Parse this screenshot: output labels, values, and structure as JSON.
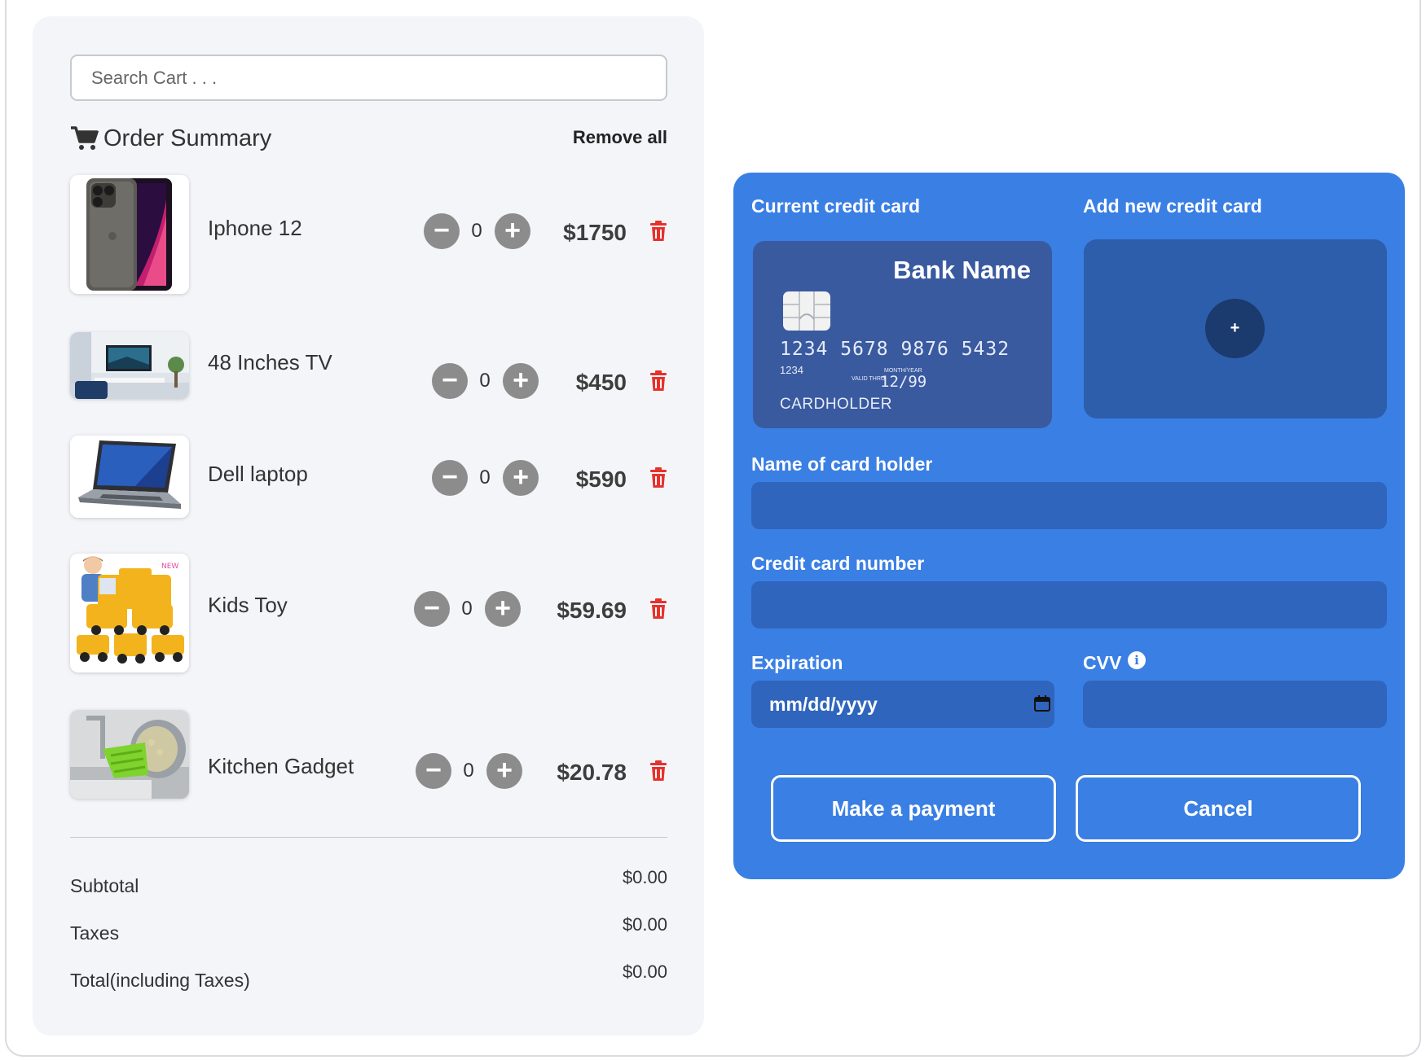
{
  "cart": {
    "search_placeholder": "Search Cart . . .",
    "title": "Order Summary",
    "remove_all": "Remove all",
    "icons": {
      "cart": "shopping-cart-icon",
      "delete": "trash-icon"
    },
    "items": [
      {
        "name": "Iphone 12",
        "qty": "0",
        "price": "$1750",
        "image": "iphone-image"
      },
      {
        "name": "48 Inches TV",
        "qty": "0",
        "price": "$450",
        "image": "tv-image"
      },
      {
        "name": "Dell laptop",
        "qty": "0",
        "price": "$590",
        "image": "laptop-image"
      },
      {
        "name": "Kids Toy",
        "qty": "0",
        "price": "$59.69",
        "image": "toy-image"
      },
      {
        "name": "Kitchen Gadget",
        "qty": "0",
        "price": "$20.78",
        "image": "kitchen-gadget-image"
      }
    ],
    "totals": [
      {
        "label": "Subtotal",
        "value": "$0.00"
      },
      {
        "label": "Taxes",
        "value": "$0.00"
      },
      {
        "label": "Total(including Taxes)",
        "value": "$0.00"
      }
    ]
  },
  "payment": {
    "current_card_label": "Current credit card",
    "add_card_label": "Add new credit card",
    "add_symbol": "+",
    "card": {
      "bank": "Bank Name",
      "number": "1234 5678 9876 5432",
      "small_number": "1234",
      "valid_thru": "VALID THRU",
      "month_year_label": "MONTH/YEAR",
      "expiry": "12/99",
      "holder": "CARDHOLDER"
    },
    "name_label": "Name of card holder",
    "number_label": "Credit card number",
    "expiration_label": "Expiration",
    "expiration_placeholder": "mm/dd/yyyy",
    "cvv_label": "CVV",
    "pay_button": "Make a payment",
    "cancel_button": "Cancel"
  },
  "colors": {
    "panel_blue": "#3a7fe4",
    "input_blue": "#2f65bd",
    "card_blue": "#3a5aa0",
    "delete_red": "#e5322d",
    "qty_button_gray": "#8c8c8c"
  }
}
